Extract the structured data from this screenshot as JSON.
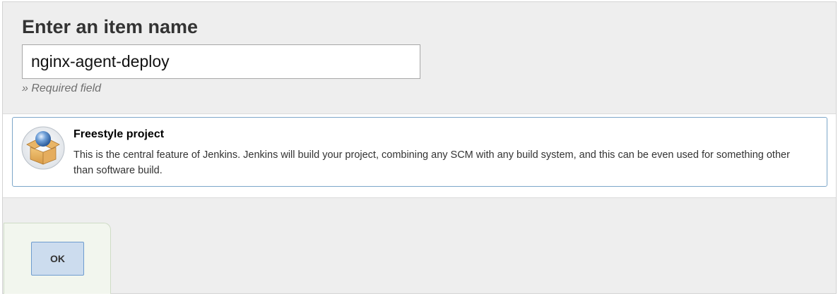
{
  "form": {
    "heading": "Enter an item name",
    "item_name_value": "nginx-agent-deploy",
    "required_hint": "» Required field"
  },
  "item_types": [
    {
      "title": "Freestyle project",
      "description": "This is the central feature of Jenkins. Jenkins will build your project, combining any SCM with any build system, and this can be even used for something other than software build.",
      "icon": "freestyle-project-box-icon"
    }
  ],
  "footer": {
    "ok_label": "OK"
  },
  "colors": {
    "card_border": "#7da7c9",
    "ok_button_bg": "#ccdcee",
    "ok_button_border": "#6e9ccf",
    "ok_panel_bg": "#f2f6ee"
  }
}
